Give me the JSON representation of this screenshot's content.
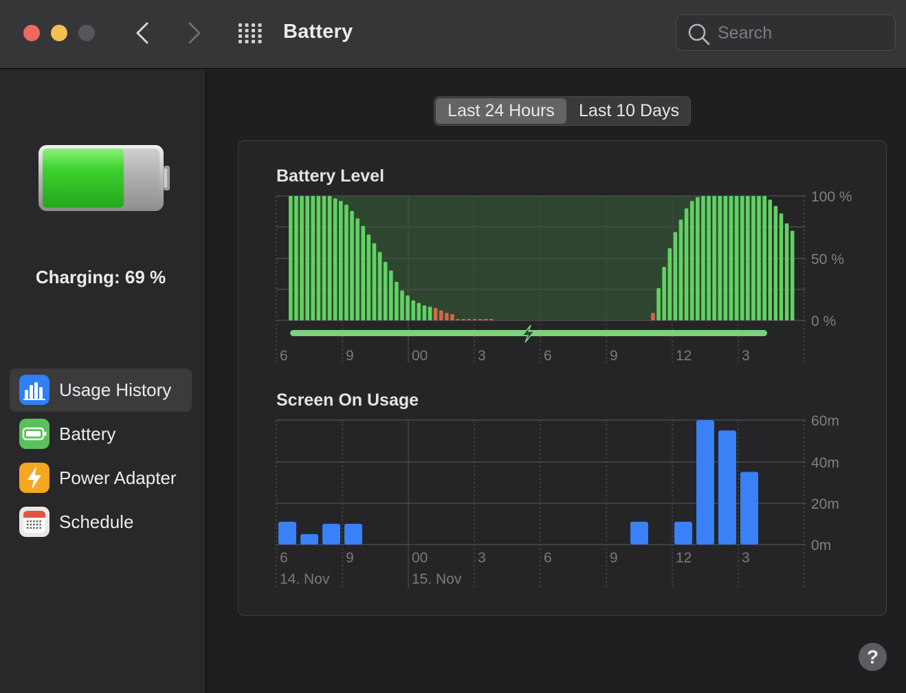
{
  "window": {
    "title": "Battery",
    "search_placeholder": "Search"
  },
  "sidebar": {
    "status": "Charging: 69 %",
    "items": [
      {
        "label": "Usage History",
        "icon": "usage-history-icon",
        "color": "#2f7ff5"
      },
      {
        "label": "Battery",
        "icon": "battery-icon",
        "color": "#5ac05c"
      },
      {
        "label": "Power Adapter",
        "icon": "power-adapter-icon",
        "color": "#f5a623"
      },
      {
        "label": "Schedule",
        "icon": "schedule-icon",
        "color": "#e9e9ea"
      }
    ]
  },
  "segmented": {
    "options": [
      "Last 24 Hours",
      "Last 10 Days"
    ],
    "selected": "Last 24 Hours"
  },
  "chart_data": [
    {
      "type": "bar",
      "title": "Battery Level",
      "unit": "%",
      "yticks": [
        "100 %",
        "50 %",
        "0 %"
      ],
      "ylim": [
        0,
        100
      ],
      "xticks": [
        "6",
        "9",
        "00",
        "3",
        "6",
        "9",
        "12",
        "3"
      ],
      "values": [
        100,
        100,
        100,
        100,
        100,
        100,
        100,
        100,
        98,
        96,
        93,
        88,
        82,
        76,
        69,
        62,
        55,
        47,
        40,
        31,
        24,
        20,
        16,
        14,
        12,
        11,
        10,
        8,
        6,
        5,
        1,
        1,
        1,
        1,
        1,
        0,
        0,
        0,
        0,
        0,
        0,
        0,
        0,
        0,
        0,
        0,
        0,
        0,
        0,
        0,
        0,
        0,
        0,
        0,
        0,
        0,
        0,
        0,
        0,
        0,
        0,
        0,
        0,
        0,
        0,
        6,
        26,
        43,
        58,
        71,
        81,
        90,
        96,
        99,
        100,
        100,
        100,
        100,
        100,
        100,
        100,
        100,
        100,
        100,
        100,
        100,
        97,
        92,
        86,
        78,
        72
      ],
      "low_color": "#d9634a",
      "color": "#62d163",
      "charging_indicator": true
    },
    {
      "type": "bar",
      "title": "Screen On Usage",
      "yticks": [
        "60m",
        "40m",
        "20m",
        "0m"
      ],
      "ylim": [
        0,
        60
      ],
      "xticks": [
        "6",
        "9",
        "00",
        "3",
        "6",
        "9",
        "12",
        "3"
      ],
      "date_labels": [
        "14. Nov",
        "15. Nov"
      ],
      "values_minutes": [
        11,
        5,
        10,
        10,
        0,
        0,
        0,
        0,
        0,
        0,
        0,
        0,
        0,
        0,
        0,
        0,
        11,
        0,
        11,
        60,
        55,
        35
      ],
      "color": "#3a80f6"
    }
  ],
  "help_label": "?"
}
